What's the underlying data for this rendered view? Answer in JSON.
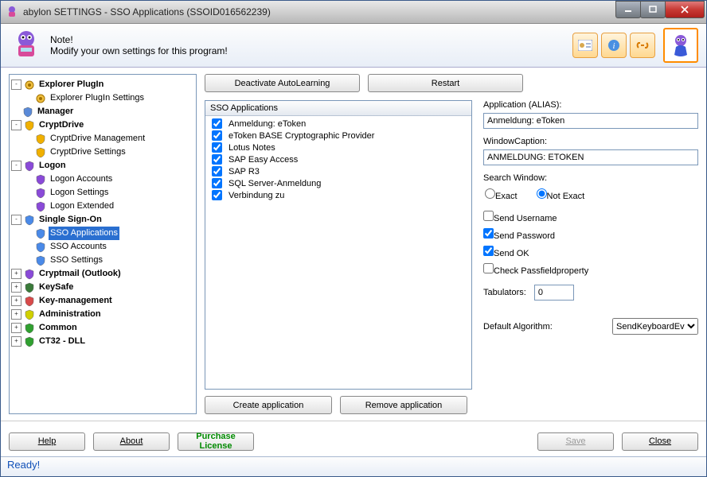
{
  "title": "abylon SETTINGS - SSO Applications (SSOID016562239)",
  "header": {
    "note_label": "Note!",
    "note_text": "Modify your own settings for this program!"
  },
  "tree": {
    "explorer_plugin": "Explorer PlugIn",
    "explorer_plugin_settings": "Explorer PlugIn Settings",
    "manager": "Manager",
    "cryptdrive": "CryptDrive",
    "cryptdrive_management": "CryptDrive Management",
    "cryptdrive_settings": "CryptDrive Settings",
    "logon": "Logon",
    "logon_accounts": "Logon Accounts",
    "logon_settings": "Logon Settings",
    "logon_extended": "Logon Extended",
    "sso": "Single Sign-On",
    "sso_applications": "SSO Applications",
    "sso_accounts": "SSO Accounts",
    "sso_settings": "SSO Settings",
    "cryptmail": "Cryptmail (Outlook)",
    "keysafe": "KeySafe",
    "key_management": "Key-management",
    "administration": "Administration",
    "common": "Common",
    "ct32": "CT32 - DLL"
  },
  "buttons": {
    "deactivate": "Deactivate AutoLearning",
    "restart": "Restart",
    "create_app": "Create application",
    "remove_app": "Remove application",
    "help": "Help",
    "about": "About",
    "purchase": "Purchase License",
    "save": "Save",
    "close": "Close"
  },
  "list": {
    "header": "SSO Applications",
    "items": [
      "Anmeldung: eToken",
      "eToken BASE Cryptographic Provider",
      "Lotus Notes",
      "SAP Easy Access",
      "SAP R3",
      "SQL Server-Anmeldung",
      "Verbindung zu"
    ]
  },
  "form": {
    "alias_label": "Application (ALIAS):",
    "alias_value": "Anmeldung: eToken",
    "caption_label": "WindowCaption:",
    "caption_value": "ANMELDUNG: ETOKEN",
    "search_label": "Search Window:",
    "exact": "Exact",
    "not_exact": "Not Exact",
    "send_username": "Send Username",
    "send_password": "Send Password",
    "send_ok": "Send OK",
    "check_passfield": "Check Passfieldproperty",
    "tabulators_label": "Tabulators:",
    "tabulators_value": "0",
    "algorithm_label": "Default Algorithm:",
    "algorithm_value": "SendKeyboardEv"
  },
  "status": "Ready!"
}
